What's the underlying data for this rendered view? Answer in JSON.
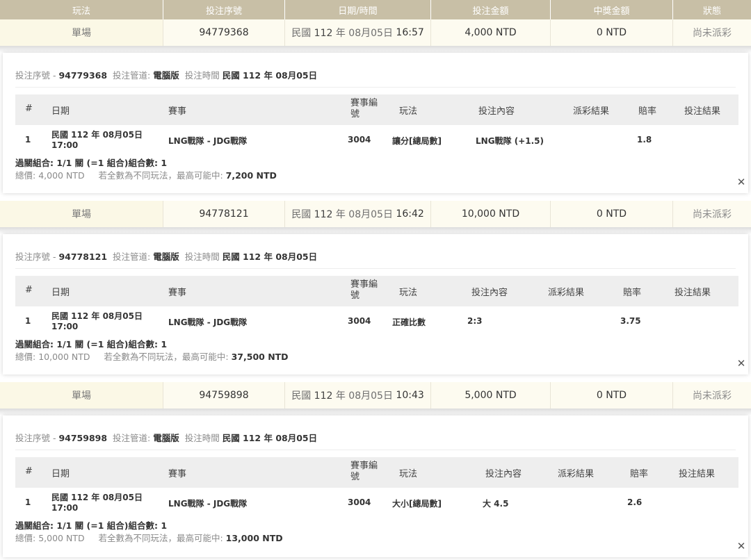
{
  "header": {
    "columns": [
      "玩法",
      "投注序號",
      "日期/時間",
      "投注金額",
      "中獎金額",
      "狀態"
    ]
  },
  "bets": [
    {
      "summary": {
        "play_type": "單場",
        "serial": "94779368",
        "date_prefix": "民國",
        "date_year": "112",
        "date_rest": "年 08月05日",
        "time": "16:57",
        "bet_amount": "4,000 NTD",
        "win_amount": "0 NTD",
        "status": "尚未派彩"
      },
      "info": {
        "serial_label": "投注序號 -",
        "serial": "94779368",
        "channel_label": "投注管道:",
        "channel": "電腦版",
        "time_label": "投注時間",
        "time": "民國 112 年 08月05日"
      },
      "table_headers": [
        "#",
        "日期",
        "賽事",
        "賽事編號",
        "玩法",
        "投注內容",
        "派彩結果",
        "賠率",
        "投注結果"
      ],
      "row": {
        "index": "1",
        "date_line1": "民國 112 年 08月05日",
        "date_line2": "17:00",
        "match": "LNG戰隊 - JDG戰隊",
        "match_no": "3004",
        "play": "讓分[總局數]",
        "content": "LNG戰隊 (+1.5)",
        "payout": "",
        "odds": "1.8",
        "result": ""
      },
      "combo": "過關組合: 1/1 關 (=1 組合)組合數: 1",
      "total_label": "總價:",
      "total_value": "4,000 NTD",
      "note": "若全數為不同玩法，最高可能中:",
      "max_win": "7,200 NTD"
    },
    {
      "summary": {
        "play_type": "單場",
        "serial": "94778121",
        "date_prefix": "民國",
        "date_year": "112",
        "date_rest": "年 08月05日",
        "time": "16:42",
        "bet_amount": "10,000 NTD",
        "win_amount": "0 NTD",
        "status": "尚未派彩"
      },
      "info": {
        "serial_label": "投注序號 -",
        "serial": "94778121",
        "channel_label": "投注管道:",
        "channel": "電腦版",
        "time_label": "投注時間",
        "time": "民國 112 年 08月05日"
      },
      "table_headers": [
        "#",
        "日期",
        "賽事",
        "賽事編號",
        "玩法",
        "投注內容",
        "派彩結果",
        "賠率",
        "投注結果"
      ],
      "row": {
        "index": "1",
        "date_line1": "民國 112 年 08月05日",
        "date_line2": "17:00",
        "match": "LNG戰隊 - JDG戰隊",
        "match_no": "3004",
        "play": "正確比數",
        "content": "2:3",
        "payout": "",
        "odds": "3.75",
        "result": ""
      },
      "combo": "過關組合: 1/1 關 (=1 組合)組合數: 1",
      "total_label": "總價:",
      "total_value": "10,000 NTD",
      "note": "若全數為不同玩法，最高可能中:",
      "max_win": "37,500 NTD"
    },
    {
      "summary": {
        "play_type": "單場",
        "serial": "94759898",
        "date_prefix": "民國",
        "date_year": "112",
        "date_rest": "年 08月05日",
        "time": "10:43",
        "bet_amount": "5,000 NTD",
        "win_amount": "0 NTD",
        "status": "尚未派彩"
      },
      "info": {
        "serial_label": "投注序號 -",
        "serial": "94759898",
        "channel_label": "投注管道:",
        "channel": "電腦版",
        "time_label": "投注時間",
        "time": "民國 112 年 08月05日"
      },
      "table_headers": [
        "#",
        "日期",
        "賽事",
        "賽事編號",
        "玩法",
        "投注內容",
        "派彩結果",
        "賠率",
        "投注結果"
      ],
      "row": {
        "index": "1",
        "date_line1": "民國 112 年 08月05日",
        "date_line2": "17:00",
        "match": "LNG戰隊 - JDG戰隊",
        "match_no": "3004",
        "play": "大小[總局數]",
        "content": "大 4.5",
        "payout": "",
        "odds": "2.6",
        "result": ""
      },
      "combo": "過關組合: 1/1 關 (=1 組合)組合數: 1",
      "total_label": "總價:",
      "total_value": "5,000 NTD",
      "note": "若全數為不同玩法，最高可能中:",
      "max_win": "13,000 NTD"
    }
  ],
  "icons": {
    "close": "close-icon"
  },
  "colors": {
    "header_bg": "#c8bfa6",
    "summary_bg": "#fdfbf0",
    "table_head_bg": "#eeeeee"
  }
}
